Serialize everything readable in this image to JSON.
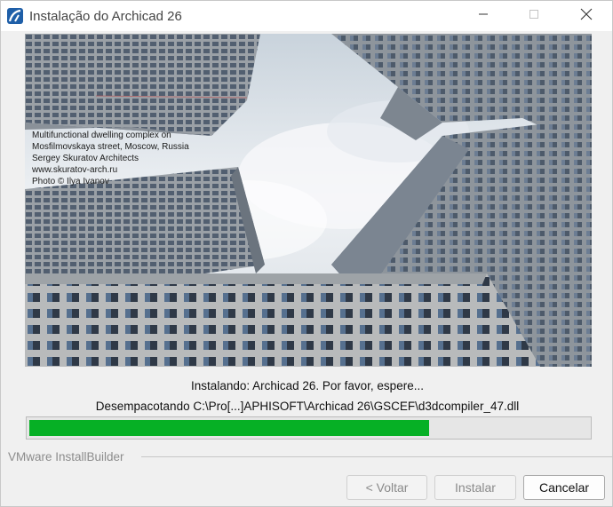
{
  "window": {
    "title": "Instalação do Archicad 26"
  },
  "banner": {
    "caption": [
      "Multifunctional dwelling complex on",
      "Mosfilmovskaya street, Moscow, Russia",
      "Sergey Skuratov Architects",
      "www.skuratov-arch.ru",
      "Photo © Ilya Ivanov"
    ]
  },
  "status": {
    "line1": "Instalando: Archicad 26. Por favor, espere...",
    "line2": "Desempacotando C:\\Pro[...]APHISOFT\\Archicad 26\\GSCEF\\d3dcompiler_47.dll"
  },
  "progress": {
    "percent": 71.5,
    "color": "#06b025"
  },
  "footer": {
    "brand": "VMware InstallBuilder",
    "back_label": "< Voltar",
    "install_label": "Instalar",
    "cancel_label": "Cancelar"
  },
  "colors": {
    "accent": "#1f5fa8"
  }
}
